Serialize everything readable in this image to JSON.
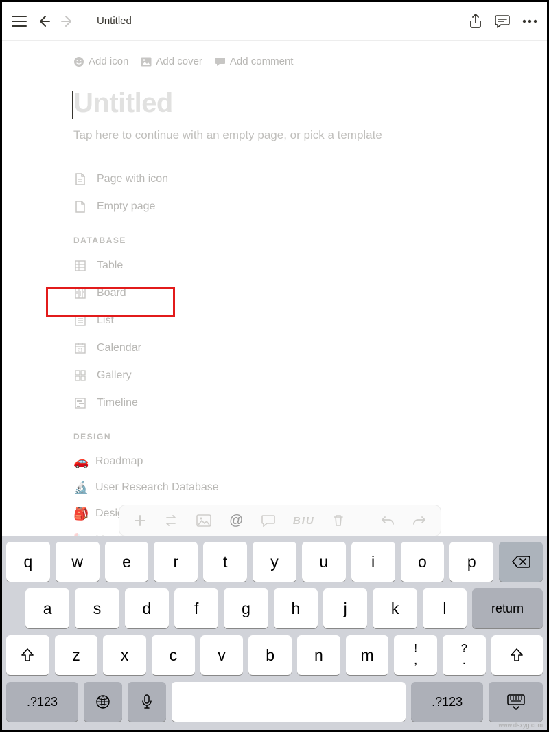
{
  "header": {
    "title": "Untitled"
  },
  "page_actions": {
    "add_icon": "Add icon",
    "add_cover": "Add cover",
    "add_comment": "Add comment"
  },
  "title_placeholder": "Untitled",
  "subtitle": "Tap here to continue with an empty page, or pick a template",
  "basic_options": [
    {
      "label": "Page with icon"
    },
    {
      "label": "Empty page"
    }
  ],
  "sections": {
    "database": {
      "title": "DATABASE",
      "items": [
        {
          "label": "Table"
        },
        {
          "label": "Board"
        },
        {
          "label": "List"
        },
        {
          "label": "Calendar"
        },
        {
          "label": "Gallery"
        },
        {
          "label": "Timeline"
        }
      ]
    },
    "design": {
      "title": "DESIGN",
      "items": [
        {
          "emoji": "🚗",
          "label": "Roadmap"
        },
        {
          "emoji": "🔬",
          "label": "User Research Database"
        },
        {
          "emoji": "🎒",
          "label": "Desig"
        },
        {
          "emoji": "✏️",
          "label": "Meeting Notes"
        }
      ]
    }
  },
  "toolbar": {
    "at": "@",
    "format": "BIU"
  },
  "keyboard": {
    "row1": [
      "q",
      "w",
      "e",
      "r",
      "t",
      "y",
      "u",
      "i",
      "o",
      "p"
    ],
    "row2": [
      "a",
      "s",
      "d",
      "f",
      "g",
      "h",
      "j",
      "k",
      "l"
    ],
    "return": "return",
    "row3": [
      "z",
      "x",
      "c",
      "v",
      "b",
      "n",
      "m"
    ],
    "punct1_top": "!",
    "punct1_bot": ",",
    "punct2_top": "?",
    "punct2_bot": ".",
    "numkey": ".?123"
  },
  "watermark": "www.dsxyg.com"
}
